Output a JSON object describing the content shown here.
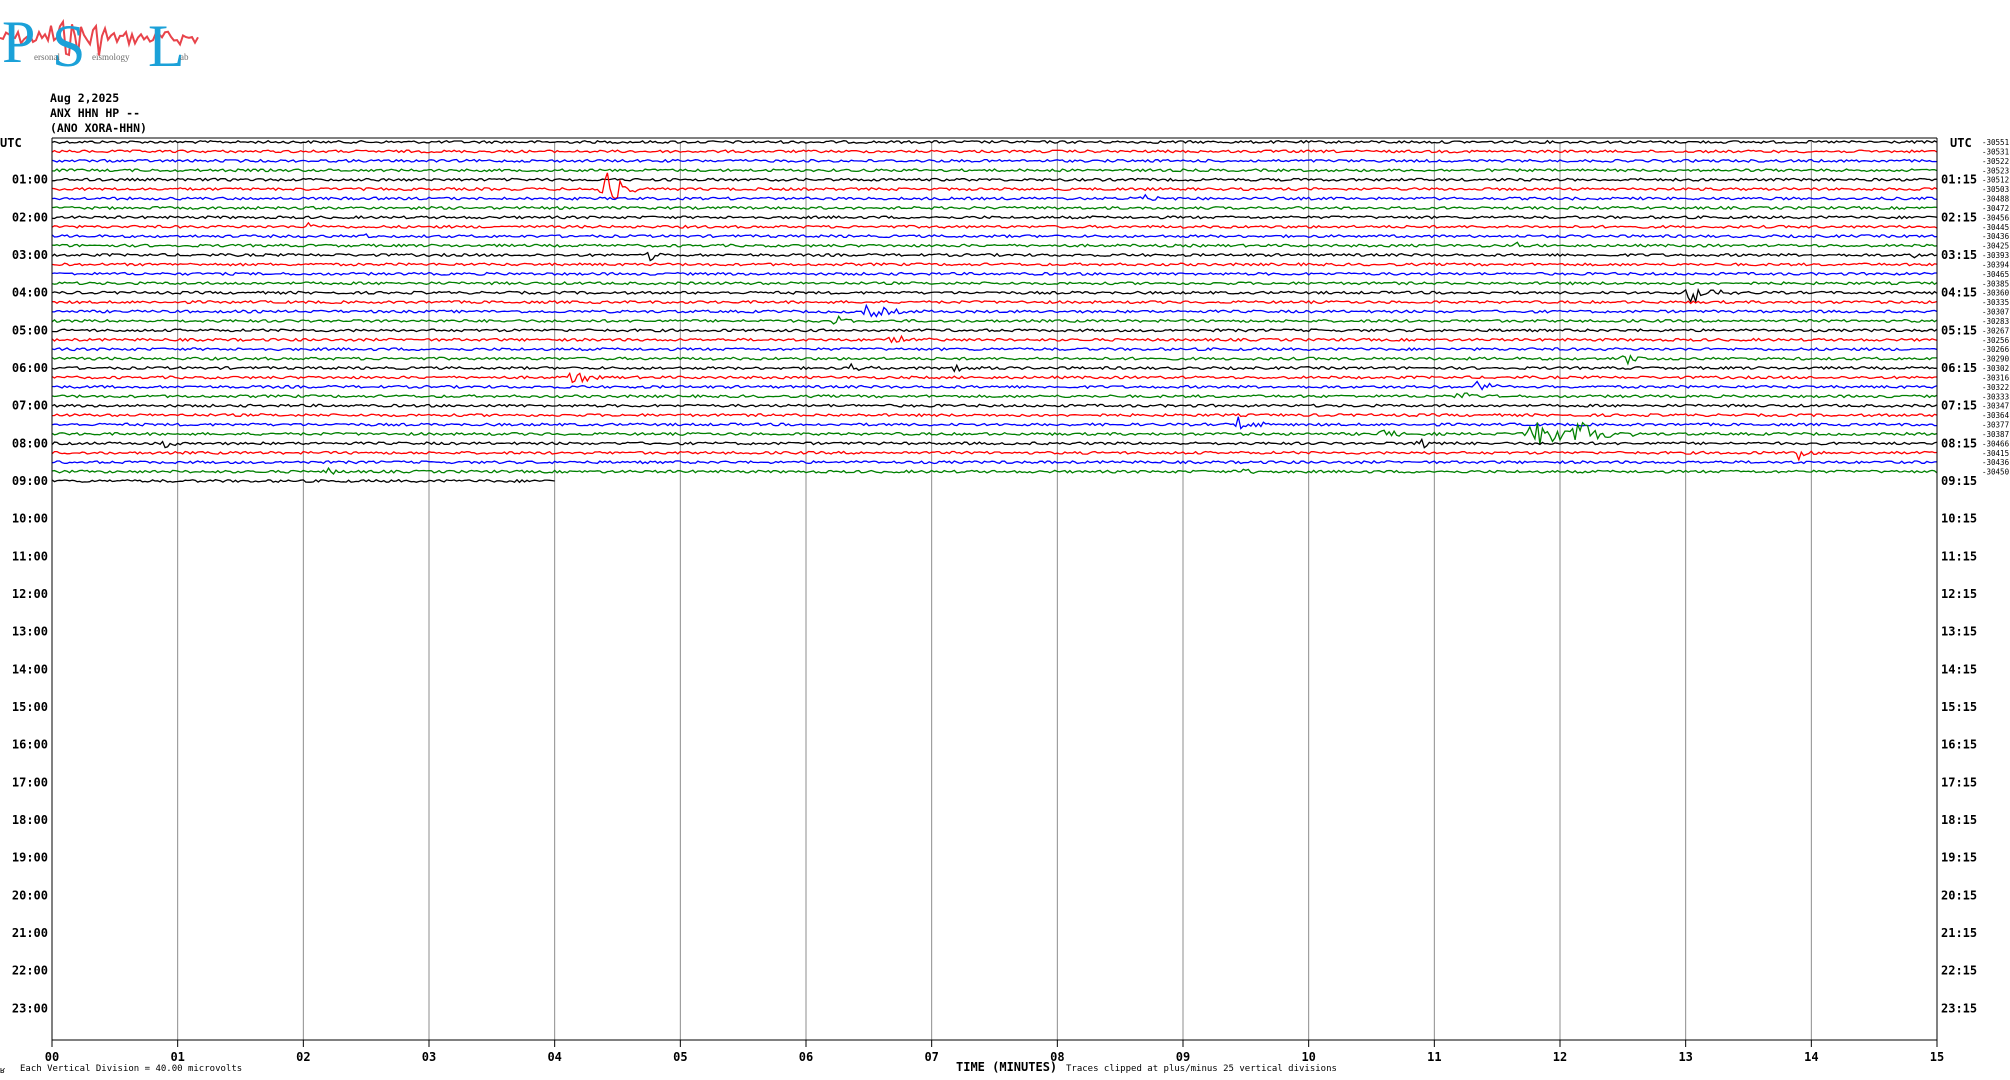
{
  "logo": {
    "letters": [
      "P",
      "S",
      "L"
    ],
    "small_text": [
      "ersonal",
      "eismology",
      "ab"
    ],
    "accent_color": "#1ba1d8",
    "wave_color": "#e8434a"
  },
  "header": {
    "date": "Aug 2,2025",
    "station": "ANX HHN HP --",
    "alias": "(ANO XORA-HHN)"
  },
  "chart_data": {
    "type": "line",
    "title": "",
    "xlabel": "TIME (MINUTES)",
    "left_axis_label": "UTC",
    "right_axis_label": "UTC",
    "xlim": [
      0,
      15
    ],
    "x_ticks": [
      "00",
      "01",
      "02",
      "03",
      "04",
      "05",
      "06",
      "07",
      "08",
      "09",
      "10",
      "11",
      "12",
      "13",
      "14",
      "15"
    ],
    "left_hour_labels": [
      "01:00",
      "02:00",
      "03:00",
      "04:00",
      "05:00",
      "06:00",
      "07:00",
      "08:00",
      "09:00",
      "10:00",
      "11:00",
      "12:00",
      "13:00",
      "14:00",
      "15:00",
      "16:00",
      "17:00",
      "18:00",
      "19:00",
      "20:00",
      "21:00",
      "22:00",
      "23:00"
    ],
    "right_hour_labels": [
      "01:15",
      "02:15",
      "03:15",
      "04:15",
      "05:15",
      "06:15",
      "07:15",
      "08:15",
      "09:15",
      "10:15",
      "11:15",
      "12:15",
      "13:15",
      "14:15",
      "15:15",
      "16:15",
      "17:15",
      "18:15",
      "19:15",
      "20:15",
      "21:15",
      "22:15",
      "23:15"
    ],
    "trace_colors": [
      "#000000",
      "#ff0000",
      "#0000ff",
      "#008000"
    ],
    "trace_count": 37,
    "last_trace_minutes": 4,
    "trace_means": [
      "-30551",
      "-30531",
      "-30522",
      "-30523",
      "-30512",
      "-30503",
      "-30488",
      "-30472",
      "-30456",
      "-30445",
      "-30436",
      "-30425",
      "-30393",
      "-30394",
      "-30465",
      "-30385",
      "-30360",
      "-30335",
      "-30307",
      "-30283",
      "-30267",
      "-30256",
      "-30266",
      "-30290",
      "-30302",
      "-30316",
      "-30322",
      "-30333",
      "-30347",
      "-30364",
      "-30377",
      "-30387",
      "-30466",
      "-30415",
      "-30436",
      "-30450"
    ],
    "events": [
      {
        "trace": 5,
        "minute": 4.4,
        "amp": 26,
        "dur": 0.2
      },
      {
        "trace": 6,
        "minute": 8.7,
        "amp": 5,
        "dur": 0.2
      },
      {
        "trace": 9,
        "minute": 2.05,
        "amp": 5,
        "dur": 0.1
      },
      {
        "trace": 10,
        "minute": 2.5,
        "amp": 4,
        "dur": 0.15
      },
      {
        "trace": 12,
        "minute": 4.75,
        "amp": 6,
        "dur": 0.2
      },
      {
        "trace": 11,
        "minute": 11.65,
        "amp": 5,
        "dur": 0.1
      },
      {
        "trace": 12,
        "minute": 14.8,
        "amp": 5,
        "dur": 0.1
      },
      {
        "trace": 16,
        "minute": 13.05,
        "amp": 14,
        "dur": 0.25
      },
      {
        "trace": 18,
        "minute": 6.5,
        "amp": 8,
        "dur": 0.3
      },
      {
        "trace": 19,
        "minute": 6.25,
        "amp": 5,
        "dur": 0.2
      },
      {
        "trace": 21,
        "minute": 6.7,
        "amp": 4,
        "dur": 0.3
      },
      {
        "trace": 23,
        "minute": 12.5,
        "amp": 7,
        "dur": 0.2
      },
      {
        "trace": 24,
        "minute": 6.35,
        "amp": 8,
        "dur": 0.15
      },
      {
        "trace": 24,
        "minute": 7.2,
        "amp": 5,
        "dur": 0.2
      },
      {
        "trace": 25,
        "minute": 4.15,
        "amp": 8,
        "dur": 0.2
      },
      {
        "trace": 26,
        "minute": 11.3,
        "amp": 6,
        "dur": 0.4
      },
      {
        "trace": 27,
        "minute": 11.2,
        "amp": 6,
        "dur": 0.2
      },
      {
        "trace": 30,
        "minute": 9.45,
        "amp": 11,
        "dur": 0.2
      },
      {
        "trace": 31,
        "minute": 11.8,
        "amp": 14,
        "dur": 0.45
      },
      {
        "trace": 31,
        "minute": 12.15,
        "amp": 16,
        "dur": 0.35
      },
      {
        "trace": 31,
        "minute": 10.6,
        "amp": 5,
        "dur": 0.3
      },
      {
        "trace": 32,
        "minute": 0.9,
        "amp": 6,
        "dur": 0.2
      },
      {
        "trace": 32,
        "minute": 10.9,
        "amp": 7,
        "dur": 0.2
      },
      {
        "trace": 33,
        "minute": 13.9,
        "amp": 7,
        "dur": 0.15
      },
      {
        "trace": 35,
        "minute": 2.2,
        "amp": 5,
        "dur": 0.1
      },
      {
        "trace": 35,
        "minute": 9.5,
        "amp": 4,
        "dur": 0.2
      }
    ]
  },
  "footer": {
    "division_text": "Each Vertical Division =   40.00 microvolts",
    "clip_text": "Traces clipped at plus/minus 25 vertical divisions",
    "corner_mark": "ʁ"
  }
}
